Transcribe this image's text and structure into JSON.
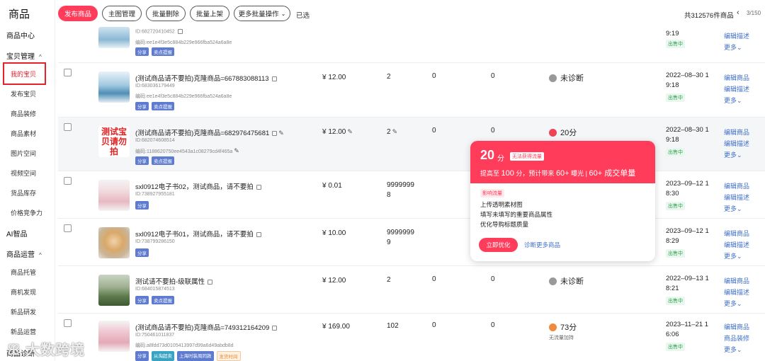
{
  "sidebar": {
    "title": "商品",
    "items": [
      {
        "label": "商品中心",
        "kind": "group"
      },
      {
        "label": "宝贝管理",
        "kind": "group",
        "caret": "^"
      },
      {
        "label": "我的宝贝",
        "kind": "item",
        "active": true
      },
      {
        "label": "发布宝贝",
        "kind": "item"
      },
      {
        "label": "商品装修",
        "kind": "item"
      },
      {
        "label": "商品素材",
        "kind": "item"
      },
      {
        "label": "图片空间",
        "kind": "item"
      },
      {
        "label": "视频空间",
        "kind": "item"
      },
      {
        "label": "货品库存",
        "kind": "item"
      },
      {
        "label": "价格竞争力",
        "kind": "item"
      },
      {
        "label": "AI智品",
        "kind": "group"
      },
      {
        "label": "商品运营",
        "kind": "group",
        "caret": "^"
      },
      {
        "label": "商品托管",
        "kind": "item"
      },
      {
        "label": "商机发现",
        "kind": "item"
      },
      {
        "label": "新品研发",
        "kind": "item"
      },
      {
        "label": "新品运营",
        "kind": "item"
      },
      {
        "label": "商品诊断",
        "kind": "group"
      }
    ]
  },
  "toolbar": {
    "publish": "发布商品",
    "main_image": "主图管理",
    "batch_delete": "批量删除",
    "batch_list": "批量上架",
    "more_batch": "更多批量操作",
    "selected": "已选",
    "total": "共312576件商品",
    "prev": "‹",
    "page": "3/150"
  },
  "rows": [
    {
      "title": "",
      "id": "ID:682720410452",
      "code": "编码:ee1e4f3e5c884b229e966fba524a6a8e",
      "tags": [
        "分享",
        "卖点提报"
      ],
      "date1": "",
      "date2": "9:19",
      "status": "出售中",
      "ops": [
        "编辑描述",
        "更多"
      ]
    },
    {
      "title": "(测试商品请不要拍)克隆商品=667883088113",
      "id": "ID:683036179449",
      "code": "编码:ee1e4f3e5c884b229e966fba524a6a8e",
      "tags": [
        "分享",
        "卖点提报"
      ],
      "price": "¥ 12.00",
      "stock": "2",
      "sales": "0",
      "col4": "0",
      "diag": "未诊断",
      "date1": "2022–08–30 1",
      "date2": "9:18",
      "status": "出售中",
      "ops": [
        "编辑商品",
        "编辑描述",
        "更多"
      ]
    },
    {
      "title": "(测试商品请不要拍)克隆商品=682976475681",
      "id": "ID:682074608514",
      "code": "编码:1188620750ee4543a1c08279cd4f465a",
      "tags": [
        "分享",
        "卖点提报"
      ],
      "thumb_text": "测试宝贝请勿拍",
      "price": "¥ 12.00",
      "stock": "2",
      "sales": "0",
      "col4": "0",
      "diag": "20分",
      "date1": "2022–08–30 1",
      "date2": "9:18",
      "status": "出售中",
      "ops": [
        "编辑商品",
        "编辑描述",
        "更多"
      ]
    },
    {
      "title": "sxl0912电子书02，测试商品，请不要拍",
      "id": "ID:738927955181",
      "tags": [
        "分享"
      ],
      "price": "¥ 0.01",
      "stock1": "9999999",
      "stock2": "8",
      "date1": "2023–09–12 1",
      "date2": "8:30",
      "status": "出售中",
      "ops": [
        "编辑商品",
        "编辑描述",
        "更多"
      ]
    },
    {
      "title": "sxl0912电子书01，测试商品，请不要拍",
      "id": "ID:738799286150",
      "tags": [
        "分享"
      ],
      "price": "¥ 10.00",
      "stock1": "9999999",
      "stock2": "9",
      "date1": "2023–09–12 1",
      "date2": "8:29",
      "status": "出售中",
      "ops": [
        "编辑商品",
        "编辑描述",
        "更多"
      ]
    },
    {
      "title": "测试请不要拍-级联属性",
      "id": "ID:684015874513",
      "tags": [
        "分享",
        "卖点提报"
      ],
      "price": "¥ 12.00",
      "stock": "2",
      "sales": "0",
      "col4": "0",
      "diag": "未诊断",
      "date1": "2022–09–13 1",
      "date2": "8:21",
      "status": "出售中",
      "ops": [
        "编辑商品",
        "编辑描述",
        "更多"
      ]
    },
    {
      "title": "(测试商品请不要拍)克隆商品=749312164209",
      "id": "ID:750461011837",
      "code": "编码:a8fdd73d0105413997d99a6d49abdb8d",
      "tags": [
        "分享",
        "从淘超卖",
        "上海时装周同款",
        "发货时间"
      ],
      "price": "¥ 169.00",
      "stock": "102",
      "sales": "0",
      "col4": "0",
      "diag": "73分",
      "diag_sub": "无流量加持",
      "date1": "2023–11–21 1",
      "date2": "6:06",
      "status": "出售中",
      "ops": [
        "编辑商品",
        "商品装修",
        "更多"
      ]
    }
  ],
  "popup": {
    "score": "20",
    "unit": "分",
    "badge": "无法获得流量",
    "line_a": "提高至",
    "line_b": "100",
    "line_c": "分，预计带来",
    "line_d": "60+",
    "line_e": "曝光",
    "line_f": "60+ 成交单量",
    "tag": "影响流量",
    "items": [
      "上传透明素材图",
      "填写未填写的重要商品属性",
      "优化导购标题质量"
    ],
    "button": "立即优化",
    "link": "诊断更多商品"
  },
  "watermark": "大数跨境",
  "colors": {
    "accent": "#ff3d5a",
    "link": "#3e6fc9",
    "status_green": "#2fa14f"
  }
}
